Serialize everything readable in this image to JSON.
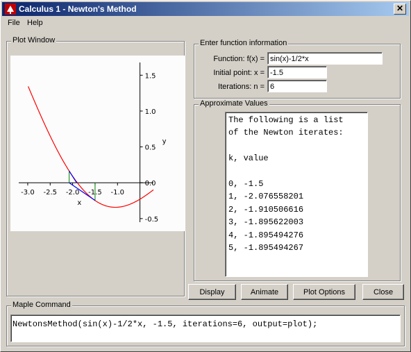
{
  "window": {
    "title": "Calculus 1 - Newton's Method",
    "close_icon": "close-icon",
    "app_icon": "maple-icon"
  },
  "menu": {
    "file": "File",
    "help": "Help"
  },
  "plot_window": {
    "legend": "Plot Window"
  },
  "function_info": {
    "legend": "Enter function information",
    "function_label": "Function:  f(x) =",
    "function_value": "sin(x)-1/2*x",
    "initial_label": "Initial point:  x =",
    "initial_value": "-1.5",
    "iterations_label": "Iterations:  n =",
    "iterations_value": "6"
  },
  "approx": {
    "legend": "Approximate Values",
    "lines": [
      "The following is a list",
      "of the Newton iterates:",
      "",
      "k, value",
      "",
      "0, -1.5",
      "1, -2.076558201",
      "2, -1.910506616",
      "3, -1.895622003",
      "4, -1.895494276",
      "5, -1.895494267"
    ]
  },
  "buttons": {
    "display": "Display",
    "animate": "Animate",
    "plot_options": "Plot Options",
    "close": "Close"
  },
  "maple_command": {
    "legend": "Maple Command",
    "value": "NewtonsMethod(sin(x)-1/2*x, -1.5, iterations=6, output=plot);"
  },
  "chart_data": {
    "type": "line",
    "function": "sin(x)-1/2*x",
    "xlabel": "x",
    "ylabel": "y",
    "xlim": [
      -3.2,
      -0.2
    ],
    "ylim": [
      -0.55,
      1.6
    ],
    "x_ticks": [
      "-3.0",
      "-2.5",
      "-2.0",
      "-1.5",
      "-1.0"
    ],
    "x_tick_values": [
      -3.0,
      -2.5,
      -2.0,
      -1.5,
      -1.0
    ],
    "y_ticks": [
      "1.5",
      "1.0",
      "0.5",
      "0.0",
      "-0.5"
    ],
    "y_tick_values": [
      1.5,
      1.0,
      0.5,
      0.0,
      -0.5
    ],
    "curve_color": "#ff0000",
    "tangent_color": "#0000ff",
    "vertical_color": "#008000",
    "iterates": [
      -1.5,
      -2.076558201,
      -1.910506616,
      -1.895622003,
      -1.895494276,
      -1.895494267
    ]
  }
}
